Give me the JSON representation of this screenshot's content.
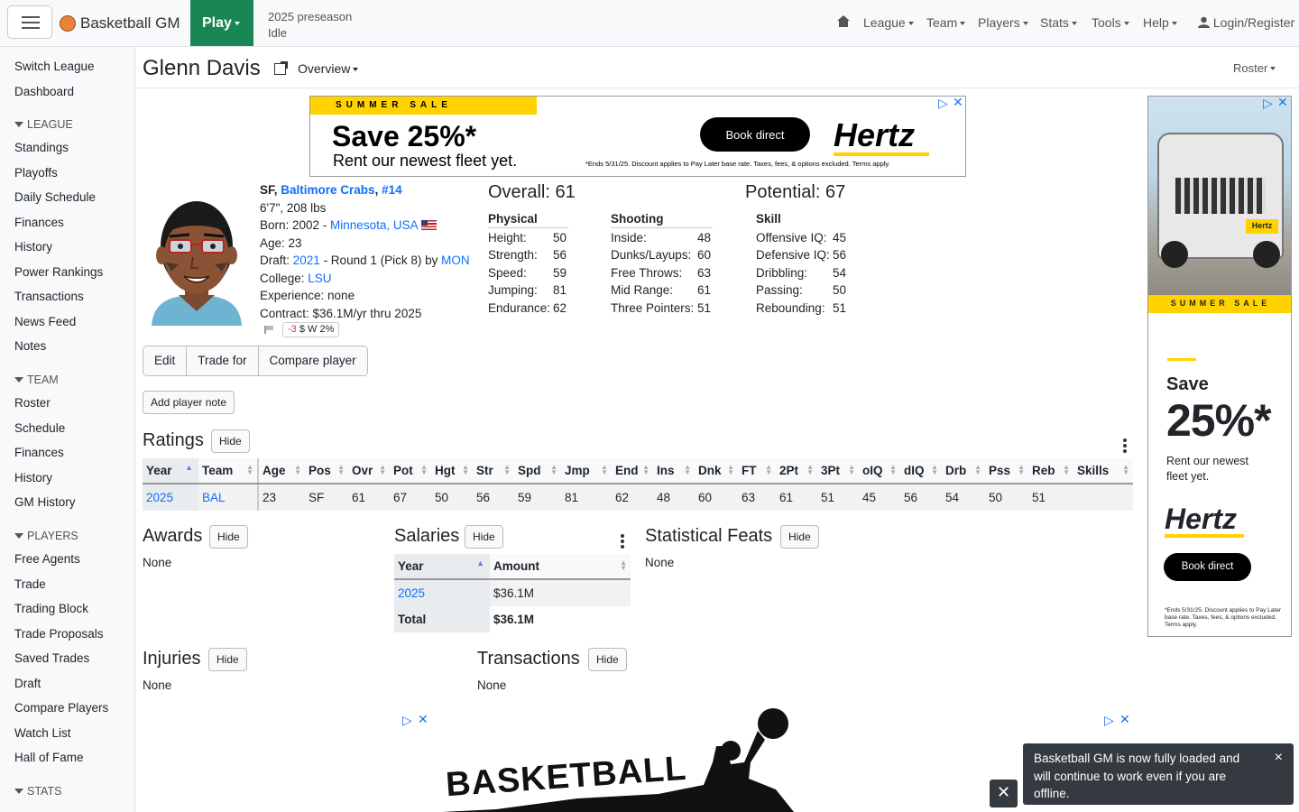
{
  "header": {
    "brand": "Basketball GM",
    "play_label": "Play",
    "status_line1": "2025 preseason",
    "status_line2": "Idle",
    "nav": [
      "League",
      "Team",
      "Players",
      "Stats",
      "Tools",
      "Help"
    ],
    "login": "Login/Register"
  },
  "sidebar": {
    "top": [
      "Switch League",
      "Dashboard"
    ],
    "league_head": "LEAGUE",
    "league": [
      "Standings",
      "Playoffs",
      "Daily Schedule",
      "Finances",
      "History",
      "Power Rankings",
      "Transactions",
      "News Feed",
      "Notes"
    ],
    "team_head": "TEAM",
    "team": [
      "Roster",
      "Schedule",
      "Finances",
      "History",
      "GM History"
    ],
    "players_head": "PLAYERS",
    "players": [
      "Free Agents",
      "Trade",
      "Trading Block",
      "Trade Proposals",
      "Saved Trades",
      "Draft",
      "Compare Players",
      "Watch List",
      "Hall of Fame"
    ],
    "stats_head": "STATS"
  },
  "page": {
    "title": "Glenn Davis",
    "overview": "Overview",
    "roster_dropdown": "Roster"
  },
  "ad_top": {
    "band": "SUMMER SALE",
    "save": "Save 25%*",
    "rent": "Rent our newest fleet yet.",
    "book": "Book direct",
    "brand": "Hertz",
    "fine": "*Ends 5/31/25. Discount applies to Pay Later base rate. Taxes, fees, & options excluded. Terms apply."
  },
  "player": {
    "pos": "SF",
    "team_name": "Baltimore Crabs",
    "number": "#14",
    "size": "6'7\", 208 lbs",
    "born_prefix": "Born: 2002 - ",
    "born_place": "Minnesota, USA",
    "age": "Age: 23",
    "draft_prefix": "Draft: ",
    "draft_year": "2021",
    "draft_mid": " - Round 1 (Pick 8) by ",
    "draft_team": "MON",
    "college_prefix": "College: ",
    "college": "LSU",
    "experience": "Experience: none",
    "contract": "Contract: $36.1M/yr thru 2025",
    "mood_delta": "-3",
    "mood_rest": "$ W 2%"
  },
  "buttons": {
    "edit": "Edit",
    "trade_for": "Trade for",
    "compare": "Compare player",
    "add_note": "Add player note",
    "hide": "Hide"
  },
  "ratings_summary": {
    "overall": "Overall: 61",
    "potential": "Potential: 67",
    "physical_head": "Physical",
    "physical": [
      [
        "Height:",
        "50"
      ],
      [
        "Strength:",
        "56"
      ],
      [
        "Speed:",
        "59"
      ],
      [
        "Jumping:",
        "81"
      ],
      [
        "Endurance:",
        "62"
      ]
    ],
    "shooting_head": "Shooting",
    "shooting": [
      [
        "Inside:",
        "48"
      ],
      [
        "Dunks/Layups:",
        "60"
      ],
      [
        "Free Throws:",
        "63"
      ],
      [
        "Mid Range:",
        "61"
      ],
      [
        "Three Pointers:",
        "51"
      ]
    ],
    "skill_head": "Skill",
    "skill": [
      [
        "Offensive IQ:",
        "45"
      ],
      [
        "Defensive IQ:",
        "56"
      ],
      [
        "Dribbling:",
        "54"
      ],
      [
        "Passing:",
        "50"
      ],
      [
        "Rebounding:",
        "51"
      ]
    ]
  },
  "ratings_table": {
    "title": "Ratings",
    "headers": [
      "Year",
      "Team",
      "Age",
      "Pos",
      "Ovr",
      "Pot",
      "Hgt",
      "Str",
      "Spd",
      "Jmp",
      "End",
      "Ins",
      "Dnk",
      "FT",
      "2Pt",
      "3Pt",
      "oIQ",
      "dIQ",
      "Drb",
      "Pss",
      "Reb",
      "Skills"
    ],
    "row": [
      "2025",
      "BAL",
      "23",
      "SF",
      "61",
      "67",
      "50",
      "56",
      "59",
      "81",
      "62",
      "48",
      "60",
      "63",
      "61",
      "51",
      "45",
      "56",
      "54",
      "50",
      "51",
      ""
    ]
  },
  "awards": {
    "title": "Awards",
    "value": "None"
  },
  "salaries": {
    "title": "Salaries",
    "headers": [
      "Year",
      "Amount"
    ],
    "row": [
      "2025",
      "$36.1M"
    ],
    "total": [
      "Total",
      "$36.1M"
    ]
  },
  "feats": {
    "title": "Statistical Feats",
    "value": "None"
  },
  "injuries": {
    "title": "Injuries",
    "value": "None"
  },
  "transactions": {
    "title": "Transactions",
    "value": "None"
  },
  "ad_side": {
    "band": "SUMMER SALE",
    "save1": "Save",
    "save2": "25%*",
    "rent": "Rent our newest fleet yet.",
    "brand": "Hertz",
    "plate": "Hertz",
    "book": "Book direct",
    "fine": "*Ends 5/31/25. Discount applies to Pay Later base rate. Taxes, fees, & options excluded. Terms apply."
  },
  "bottom_ad": {
    "text": "BASKETBALL"
  },
  "toast": {
    "message": "Basketball GM is now fully loaded and will continue to work even if you are offline.",
    "close": "×"
  }
}
